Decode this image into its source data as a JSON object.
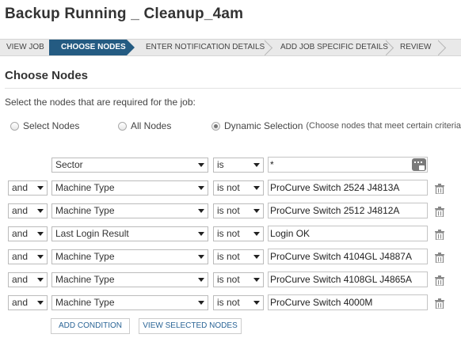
{
  "page_title": "Backup Running _ Cleanup_4am",
  "wizard": {
    "steps": [
      "VIEW JOB",
      "CHOOSE NODES",
      "ENTER NOTIFICATION DETAILS",
      "ADD JOB SPECIFIC DETAILS",
      "REVIEW"
    ],
    "active_step": "CHOOSE NODES"
  },
  "section_title": "Choose Nodes",
  "instruction": "Select the nodes that are required for the job:",
  "selection_mode": {
    "options": [
      "Select Nodes",
      "All Nodes",
      "Dynamic Selection"
    ],
    "selected": "Dynamic Selection",
    "dynamic_hint": "(Choose nodes that meet certain criteria)"
  },
  "conditions": [
    {
      "connector": "",
      "field": "Sector",
      "operator": "is",
      "value": "*"
    },
    {
      "connector": "and",
      "field": "Machine Type",
      "operator": "is not",
      "value": "ProCurve Switch 2524 J4813A"
    },
    {
      "connector": "and",
      "field": "Machine Type",
      "operator": "is not",
      "value": "ProCurve Switch 2512 J4812A"
    },
    {
      "connector": "and",
      "field": "Last Login Result",
      "operator": "is not",
      "value": "Login OK"
    },
    {
      "connector": "and",
      "field": "Machine Type",
      "operator": "is not",
      "value": "ProCurve Switch 4104GL J4887A"
    },
    {
      "connector": "and",
      "field": "Machine Type",
      "operator": "is not",
      "value": "ProCurve Switch 4108GL J4865A"
    },
    {
      "connector": "and",
      "field": "Machine Type",
      "operator": "is not",
      "value": "ProCurve Switch 4000M"
    }
  ],
  "buttons": {
    "add_condition": "ADD CONDITION",
    "view_selected": "VIEW SELECTED NODES"
  },
  "icons": {
    "delete": "trash-icon",
    "insert_variable": "insert-variable-icon"
  },
  "colors": {
    "active_step_bg": "#245b82",
    "link_text": "#2a6496"
  }
}
